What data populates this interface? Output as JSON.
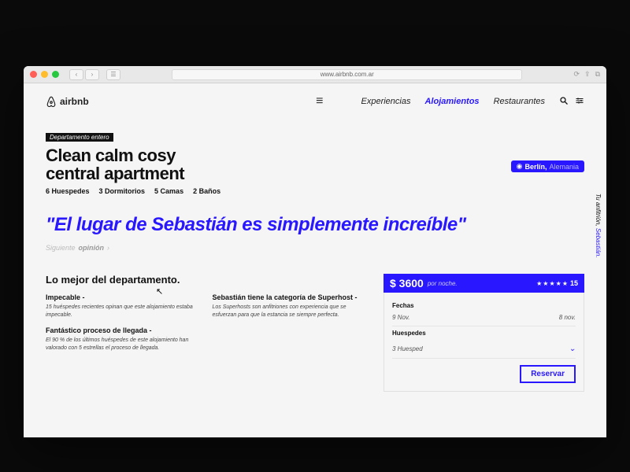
{
  "url": "www.airbnb.com.ar",
  "brand": "airbnb",
  "nav": {
    "exp": "Experiencias",
    "aloj": "Alojamientos",
    "rest": "Restaurantes"
  },
  "listing": {
    "badge": "Departamento entero",
    "title_l1": "Clean calm cosy",
    "title_l2": "central apartment",
    "specs": {
      "guests": "6 Huespedes",
      "bedrooms": "3 Dormitorios",
      "beds": "5 Camas",
      "baths": "2 Baños"
    },
    "location_city": "Berlín,",
    "location_country": "Alemania"
  },
  "quote": "\"El lugar de Sebastián es simplemente increíble\"",
  "next_opinion_pre": "Siguiente",
  "next_opinion_bold": "opinión",
  "host_label": "Tu anfitrión,",
  "host_name": "Sebastián.",
  "best": {
    "heading": "Lo mejor del departamento.",
    "left": {
      "t1": "Impecable -",
      "d1": "15 huéspedes recientes opinan que este alojamiento estaba impecable.",
      "t2": "Fantástico proceso de llegada -",
      "d2": "El 90 % de los últimos huéspedes de este alojamiento han valorado con 5 estrellas el proceso de llegada."
    },
    "right": {
      "t1": "Sebastián  tiene la categoría de Superhost  -",
      "d1": "Los Superhosts son anfitriones con experiencia que se esfuerzan para que la estancia se siempre perfecta."
    }
  },
  "booking": {
    "price": "$ 3600",
    "per": "por noche.",
    "stars": "★★★★★",
    "review_count": "15",
    "dates_label": "Fechas",
    "date_in": "9 Nov.",
    "date_out": "8 nov.",
    "guests_label": "Huespedes",
    "guests_value": "3 Huesped",
    "reserve": "Reservar"
  }
}
